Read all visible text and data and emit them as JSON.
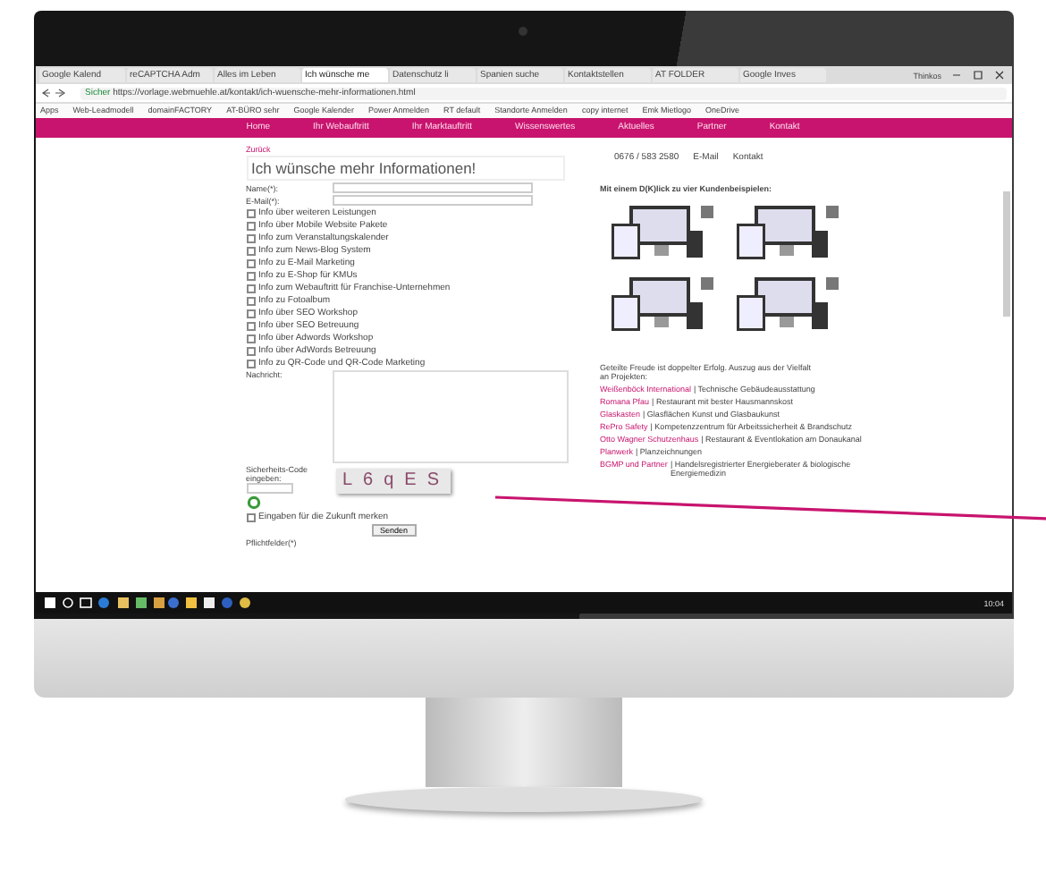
{
  "browser": {
    "tabs": [
      {
        "label": "Google Kalend",
        "selected": false
      },
      {
        "label": "reCAPTCHA Adm",
        "selected": false
      },
      {
        "label": "Alles im Leben",
        "selected": false
      },
      {
        "label": "Ich wünsche me",
        "selected": true
      },
      {
        "label": "Datenschutz li",
        "selected": false
      },
      {
        "label": "Spanien suche",
        "selected": false
      },
      {
        "label": "Kontaktstellen",
        "selected": false
      },
      {
        "label": "AT FOLDER",
        "selected": false
      },
      {
        "label": "Google Inves",
        "selected": false
      }
    ],
    "user": "Thinkos",
    "secure_label": "Sicher",
    "url": "https://vorlage.webmuehle.at/kontakt/ich-wuensche-mehr-informationen.html",
    "bookmarks": [
      "Apps",
      "Web-Leadmodell",
      "domainFACTORY",
      "AT-BÜRO sehr",
      "Google Kalender",
      "Power Anmelden",
      "RT default",
      "Standorte Anmelden",
      "copy internet",
      "Emk Mietlogo",
      "OneDrive"
    ]
  },
  "site": {
    "nav": [
      "Home",
      "Ihr Webauftritt",
      "Ihr Marktauftritt",
      "Wissenswertes",
      "Aktuelles",
      "Partner",
      "Kontakt"
    ],
    "breadcrumb": "Zurück",
    "heading": "Ich wünsche mehr Informationen!",
    "fields": [
      {
        "label": "Name(*):"
      },
      {
        "label": "E-Mail(*):"
      }
    ],
    "options": [
      {
        "label": "Info über weiteren Leistungen",
        "checked": false
      },
      {
        "label": "Info über Mobile Website Pakete",
        "checked": false
      },
      {
        "label": "Info zum Veranstaltungskalender",
        "checked": false
      },
      {
        "label": "Info zum News-Blog System",
        "checked": false
      },
      {
        "label": "Info zu E-Mail Marketing",
        "checked": false
      },
      {
        "label": "Info zu E-Shop für KMUs",
        "checked": false
      },
      {
        "label": "Info zum Webauftritt für Franchise-Unternehmen",
        "checked": false
      },
      {
        "label": "Info zu Fotoalbum",
        "checked": false
      },
      {
        "label": "Info über SEO Workshop",
        "checked": false
      },
      {
        "label": "Info über SEO Betreuung",
        "checked": false
      },
      {
        "label": "Info über Adwords Workshop",
        "checked": false
      },
      {
        "label": "Info über AdWords Betreuung",
        "checked": false
      },
      {
        "label": "Info zu QR-Code und QR-Code Marketing",
        "checked": false
      }
    ],
    "message_label": "Nachricht:",
    "captcha_label": "Sicherheits-Code eingeben:",
    "captcha": "L6qES",
    "consent": {
      "label": "Eingaben für die Zukunft merken",
      "checked": false
    },
    "submit": "Senden",
    "required_note": "Pflichtfelder(*)",
    "contacts": [
      "0676 / 583 2580",
      "E-Mail",
      "Kontakt"
    ],
    "examples_heading": "Mit einem D(K)lick zu vier Kundenbeispielen:",
    "intro": "Geteilte Freude ist doppelter Erfolg. Auszug aus der Vielfalt an Projekten:",
    "references": [
      {
        "name": "Weißenböck International",
        "desc": "| Technische Gebäudeausstattung"
      },
      {
        "name": "Romana Pfau",
        "desc": "| Restaurant mit bester Hausmannskost"
      },
      {
        "name": "Glaskasten",
        "desc": "| Glasflächen Kunst und Glasbaukunst"
      },
      {
        "name": "RePro Safety",
        "desc": "| Kompetenzzentrum für Arbeitssicherheit & Brandschutz"
      },
      {
        "name": "Otto Wagner Schutzenhaus",
        "desc": "| Restaurant & Eventlokation am Donaukanal"
      },
      {
        "name": "Planwerk",
        "desc": "| Planzeichnungen"
      },
      {
        "name": "BGMP und Partner",
        "desc": "| Handelsregistrierter Energieberater & biologische Energiemedizin"
      }
    ]
  },
  "taskbar": {
    "clock": "10:04"
  }
}
